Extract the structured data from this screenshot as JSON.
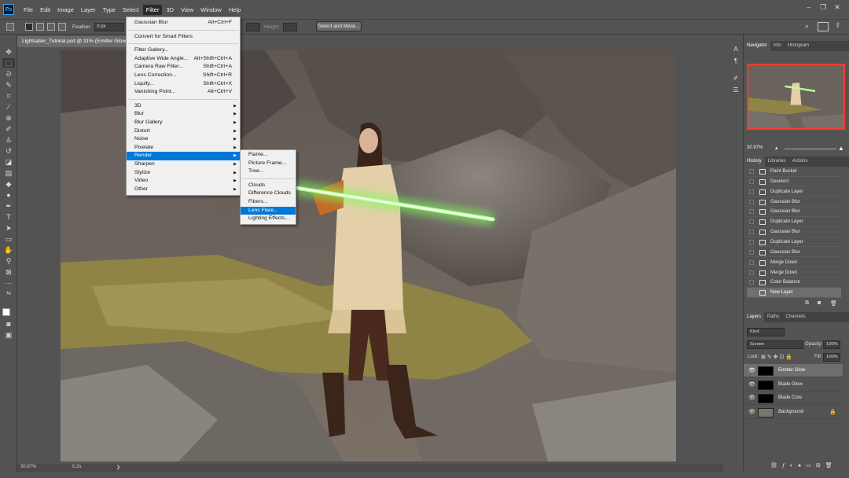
{
  "menubar": {
    "logo": "Ps",
    "items": [
      "File",
      "Edit",
      "Image",
      "Layer",
      "Type",
      "Select",
      "Filter",
      "3D",
      "View",
      "Window",
      "Help"
    ],
    "active": "Filter",
    "window_controls": [
      "–",
      "❐",
      "✕"
    ]
  },
  "options": {
    "feather_label": "Feather:",
    "feather_value": "0 px",
    "height_label": "Height:",
    "select_mask": "Select and Mask..."
  },
  "document": {
    "tab_title": "Lightsaber_Tutorial.psd @ 31% (Emitter Glow",
    "status_zoom": "30.97%",
    "status_info": "0.2s",
    "status_arrow": "❯"
  },
  "filter_menu": {
    "items": [
      {
        "label": "Gaussian Blur",
        "shortcut": "Alt+Ctrl+F"
      },
      {
        "sep": true
      },
      {
        "label": "Convert for Smart Filters"
      },
      {
        "sep": true
      },
      {
        "label": "Filter Gallery..."
      },
      {
        "label": "Adaptive Wide Angle...",
        "shortcut": "Alt+Shift+Ctrl+A"
      },
      {
        "label": "Camera Raw Filter...",
        "shortcut": "Shift+Ctrl+A"
      },
      {
        "label": "Lens Correction...",
        "shortcut": "Shift+Ctrl+R"
      },
      {
        "label": "Liquify...",
        "shortcut": "Shift+Ctrl+X"
      },
      {
        "label": "Vanishing Point...",
        "shortcut": "Alt+Ctrl+V"
      },
      {
        "sep": true
      },
      {
        "label": "3D",
        "sub": true
      },
      {
        "label": "Blur",
        "sub": true
      },
      {
        "label": "Blur Gallery",
        "sub": true
      },
      {
        "label": "Distort",
        "sub": true
      },
      {
        "label": "Noise",
        "sub": true
      },
      {
        "label": "Pixelate",
        "sub": true
      },
      {
        "label": "Render",
        "sub": true,
        "highlight": true
      },
      {
        "label": "Sharpen",
        "sub": true
      },
      {
        "label": "Stylize",
        "sub": true
      },
      {
        "label": "Video",
        "sub": true
      },
      {
        "label": "Other",
        "sub": true
      }
    ]
  },
  "render_menu": {
    "items": [
      {
        "label": "Flame..."
      },
      {
        "label": "Picture Frame..."
      },
      {
        "label": "Tree..."
      },
      {
        "sep": true
      },
      {
        "label": "Clouds"
      },
      {
        "label": "Difference Clouds"
      },
      {
        "label": "Fibers..."
      },
      {
        "label": "Lens Flare...",
        "highlight": true
      },
      {
        "label": "Lighting Effects..."
      }
    ]
  },
  "navigator": {
    "tabs": [
      "Navigator",
      "Info",
      "Histogram"
    ],
    "zoom": "30.97%"
  },
  "history": {
    "tabs": [
      "History",
      "Libraries",
      "Actions"
    ],
    "items": [
      "Paint Bucket",
      "Deselect",
      "Duplicate Layer",
      "Gaussian Blur",
      "Gaussian Blur",
      "Duplicate Layer",
      "Gaussian Blur",
      "Duplicate Layer",
      "Gaussian Blur",
      "Merge Down",
      "Merge Down",
      "Color Balance",
      "New Layer"
    ],
    "current": "New Layer"
  },
  "layers": {
    "tabs": [
      "Layers",
      "Paths",
      "Channels"
    ],
    "filter_kind": "Kind",
    "blend_mode": "Screen",
    "opacity_label": "Opacity:",
    "opacity": "100%",
    "lock_label": "Lock:",
    "fill_label": "Fill:",
    "fill": "100%",
    "items": [
      {
        "name": "Emitter Glow",
        "selected": true
      },
      {
        "name": "Blade Glow"
      },
      {
        "name": "Blade Core"
      },
      {
        "name": "Background",
        "italic": true,
        "locked": true
      }
    ]
  }
}
